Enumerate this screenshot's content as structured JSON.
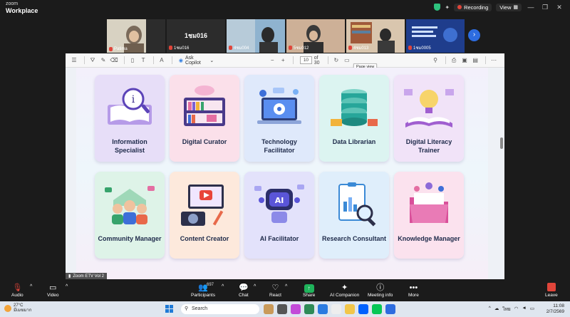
{
  "titlebar": {
    "brand_top": "zoom",
    "brand_bottom": "Workplace",
    "recording_label": "Recording",
    "view_label": "View",
    "icons": [
      "shield-icon",
      "minimize-icon",
      "maximize-icon",
      "close-icon"
    ]
  },
  "video_strip": {
    "tiles": [
      {
        "name": "Patima",
        "bg": "#c9c0a8"
      },
      {
        "name": "1ชม016",
        "center_name": "1ชม016",
        "bg": "#2c2c2c"
      },
      {
        "name": "4ชม004",
        "bg": "#7ba3c2"
      },
      {
        "name": "5ชม012",
        "bg": "#c9a88c"
      },
      {
        "name": "4ชม013",
        "bg": "#d7c2a8"
      },
      {
        "name": "1ชม0005",
        "bg": "#1f3d8c"
      }
    ]
  },
  "pdf_toolbar": {
    "ask_copilot": "Ask Copilot",
    "page_current": "10",
    "page_of": "of 30",
    "tooltip": "Page view"
  },
  "cards": [
    {
      "label": "Information Specialist",
      "color": "#e7def8",
      "accent": "#7b5fd3",
      "icon": "book-info-icon"
    },
    {
      "label": "Digital Curator",
      "color": "#fbe0ea",
      "accent": "#e46ea2",
      "icon": "bookshelf-icon"
    },
    {
      "label": "Technology Facilitator",
      "color": "#dfe9fb",
      "accent": "#3d6fd8",
      "icon": "laptop-gear-icon"
    },
    {
      "label": "Data Librarian",
      "color": "#dcf4f1",
      "accent": "#27a69a",
      "icon": "database-icon"
    },
    {
      "label": "Digital Literacy Trainer",
      "color": "#f1e3f8",
      "accent": "#a05fd0",
      "icon": "lightbulb-book-icon"
    },
    {
      "label": "Community Manager",
      "color": "#def3e8",
      "accent": "#37a36c",
      "icon": "people-icon"
    },
    {
      "label": "Content Creator",
      "color": "#fde9dc",
      "accent": "#e8694a",
      "icon": "camera-video-icon"
    },
    {
      "label": "AI Facilitator",
      "color": "#e3e2fb",
      "accent": "#5a55d8",
      "icon": "robot-icon"
    },
    {
      "label": "Research Consultant",
      "color": "#dfeefb",
      "accent": "#3b8ad6",
      "icon": "clipboard-magnifier-icon"
    },
    {
      "label": "Knowledge Manager",
      "color": "#fbe2ee",
      "accent": "#d9509a",
      "icon": "folder-icon"
    }
  ],
  "overlay": {
    "label": "Zoom ETV Vol 2"
  },
  "controls": {
    "audio": "Audio",
    "video": "Video",
    "participants": "Participants",
    "participants_count": "697",
    "chat": "Chat",
    "react": "React",
    "share": "Share",
    "ai_companion": "AI Companion",
    "meeting_info": "Meeting info",
    "more": "More",
    "leave": "Leave"
  },
  "taskbar": {
    "temp": "27°C",
    "weather_desc": "มีเมฆมาก",
    "search": "Search",
    "lang": "ไทย",
    "time": "11:08",
    "date": "2/7/2569"
  }
}
